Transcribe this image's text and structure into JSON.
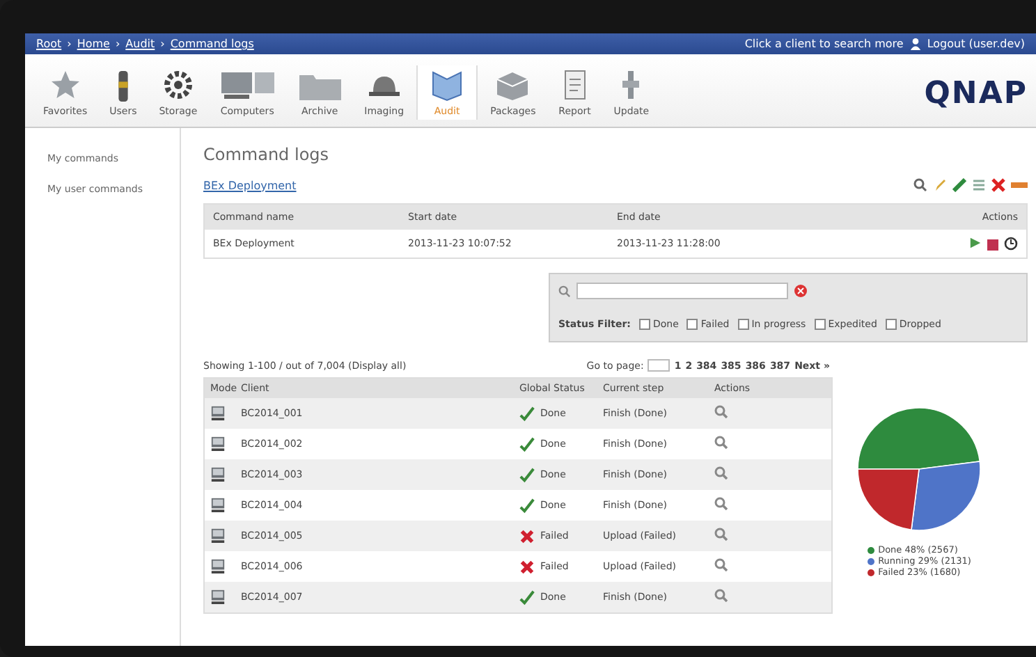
{
  "top_bar": {
    "breadcrumb": [
      "Root",
      "Home",
      "Audit",
      "Command logs"
    ],
    "separator": "›",
    "hint": "Click a client to search more",
    "user": "Logout (user.dev)"
  },
  "toolbar": [
    {
      "label": "Favorites",
      "selected": false
    },
    {
      "label": "Users",
      "selected": false
    },
    {
      "label": "Storage",
      "selected": false
    },
    {
      "label": "Computers",
      "selected": false
    },
    {
      "label": "Archive",
      "selected": false
    },
    {
      "label": "Imaging",
      "selected": false
    },
    {
      "label": "Audit",
      "selected": true
    },
    {
      "label": "Packages",
      "selected": false
    },
    {
      "label": "Report",
      "selected": false
    },
    {
      "label": "Update",
      "selected": false
    }
  ],
  "logo": "QNAP",
  "sidebar": {
    "items": [
      {
        "label": "My commands",
        "selected": false
      },
      {
        "label": "My user commands",
        "selected": false
      }
    ]
  },
  "page": {
    "title": "Command logs",
    "link": "BEx Deployment"
  },
  "command_table": {
    "columns": [
      "Command name",
      "Start date",
      "End date",
      "Actions"
    ],
    "rows": [
      {
        "name": "BEx Deployment",
        "start": "2013-11-23 10:07:52",
        "end": "2013-11-23 11:28:00"
      }
    ]
  },
  "filter": {
    "status_label": "Status Filter:",
    "options": [
      {
        "label": "Done",
        "checked": false
      },
      {
        "label": "Failed",
        "checked": false
      },
      {
        "label": "In progress",
        "checked": false
      },
      {
        "label": "Expedited",
        "checked": false
      },
      {
        "label": "Dropped",
        "checked": false
      }
    ]
  },
  "summary": "Showing 1-100 / out of 7,004 (Display all)",
  "pagination": {
    "label": "Go to page:",
    "pages": [
      "1",
      "2",
      "384",
      "385",
      "386",
      "387"
    ],
    "next": "Next »"
  },
  "client_table": {
    "columns": [
      "Mode",
      "Client",
      "Global Status",
      "Current step",
      "Actions"
    ],
    "rows": [
      {
        "client": "BC2014_001",
        "kind": "done",
        "status": "Done",
        "step": "Finish (Done)"
      },
      {
        "client": "BC2014_002",
        "kind": "done",
        "status": "Done",
        "step": "Finish (Done)"
      },
      {
        "client": "BC2014_003",
        "kind": "done",
        "status": "Done",
        "step": "Finish (Done)"
      },
      {
        "client": "BC2014_004",
        "kind": "done",
        "status": "Done",
        "step": "Finish (Done)"
      },
      {
        "client": "BC2014_005",
        "kind": "failed",
        "status": "Failed",
        "step": "Upload (Failed)"
      },
      {
        "client": "BC2014_006",
        "kind": "failed",
        "status": "Failed",
        "step": "Upload (Failed)"
      },
      {
        "client": "BC2014_007",
        "kind": "done",
        "status": "Done",
        "step": "Finish (Done)"
      }
    ]
  },
  "status_chart": {
    "chart_data": {
      "type": "pie",
      "categories": [
        "Done 48% (2567)",
        "Running 29% (2131)",
        "Failed 23% (1680)"
      ],
      "series": [
        {
          "values": [
            48,
            29,
            23
          ]
        }
      ],
      "colors": [
        "#2e8b3e",
        "#4f74c8",
        "#c0282c"
      ],
      "legend": "bottom"
    }
  }
}
